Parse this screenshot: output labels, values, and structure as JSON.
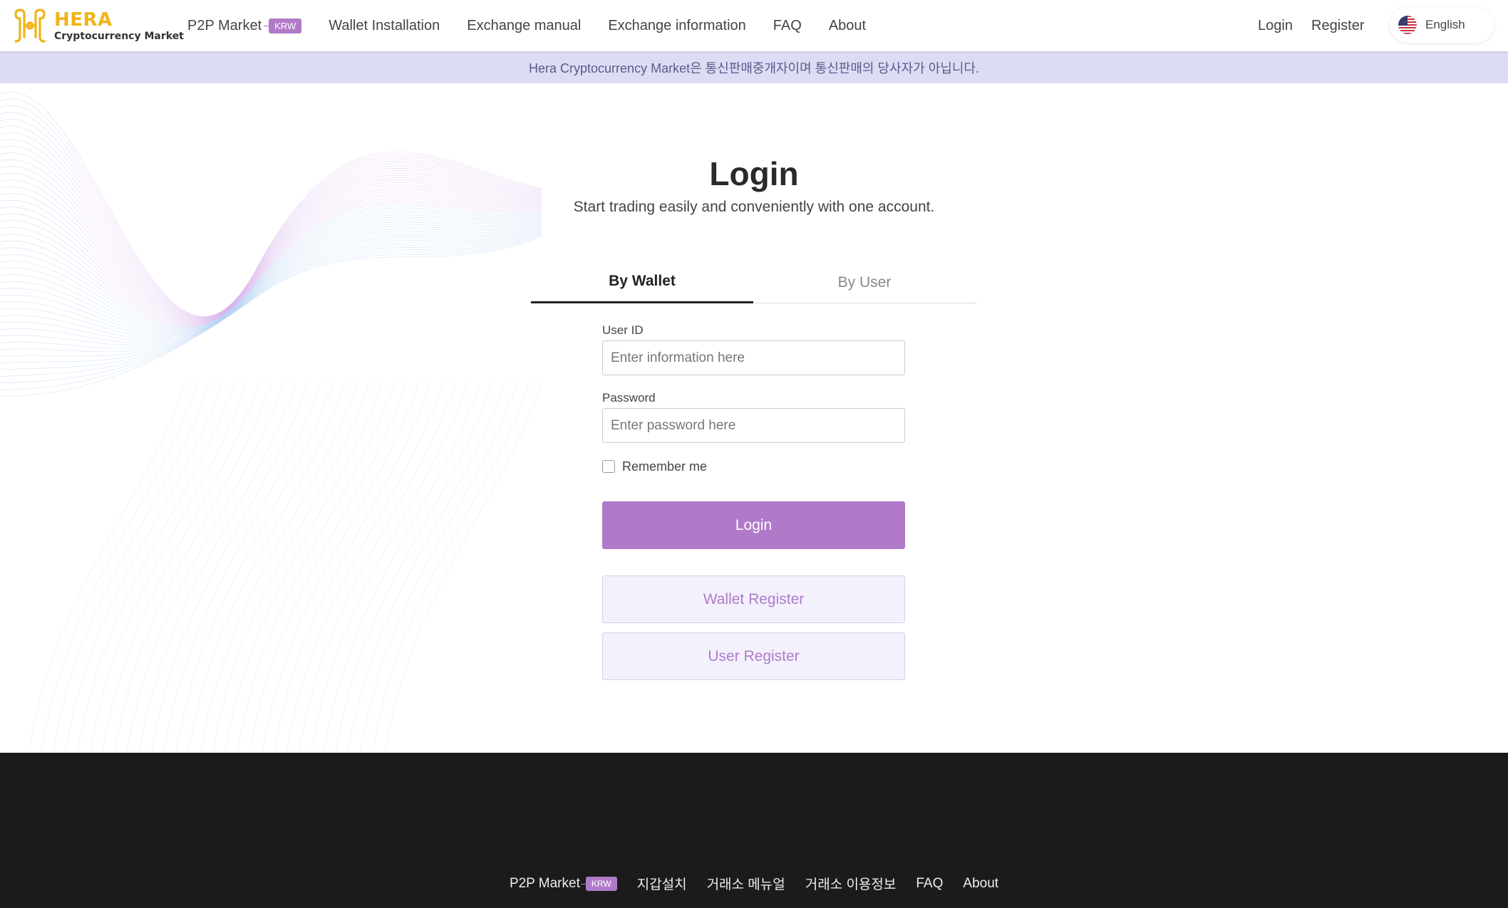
{
  "header": {
    "logo_title": "HERA",
    "logo_subtitle": "Cryptocurrency Market",
    "nav": [
      {
        "label": "P2P Market",
        "badge": "KRW"
      },
      {
        "label": "Wallet Installation"
      },
      {
        "label": "Exchange manual"
      },
      {
        "label": "Exchange information"
      },
      {
        "label": "FAQ"
      },
      {
        "label": "About"
      }
    ],
    "login_label": "Login",
    "register_label": "Register",
    "language": {
      "label": "English",
      "icon": "us-flag-icon"
    }
  },
  "notice": {
    "text": "Hera Cryptocurrency Market은 통신판매중개자이며 통신판매의 당사자가 아닙니다."
  },
  "main": {
    "title": "Login",
    "subtitle": "Start trading easily and conveniently with one account.",
    "tabs": [
      {
        "label": "By Wallet",
        "active": true
      },
      {
        "label": "By User",
        "active": false
      }
    ],
    "form": {
      "user_id_label": "User ID",
      "user_id_placeholder": "Enter information here",
      "user_id_value": "",
      "password_label": "Password",
      "password_placeholder": "Enter password here",
      "password_value": "",
      "remember_label": "Remember me",
      "remember_checked": false,
      "login_button": "Login",
      "wallet_register_button": "Wallet Register",
      "user_register_button": "User Register"
    }
  },
  "footer": {
    "nav": [
      {
        "label": "P2P Market",
        "badge": "KRW"
      },
      {
        "label": "지갑설치"
      },
      {
        "label": "거래소 메뉴얼"
      },
      {
        "label": "거래소 이용정보"
      },
      {
        "label": "FAQ"
      },
      {
        "label": "About"
      }
    ]
  },
  "colors": {
    "accent": "#b07ac9",
    "logo": "#f0b41a",
    "notice_bg": "#dcdcf5",
    "footer_bg": "#1b1b1b"
  }
}
